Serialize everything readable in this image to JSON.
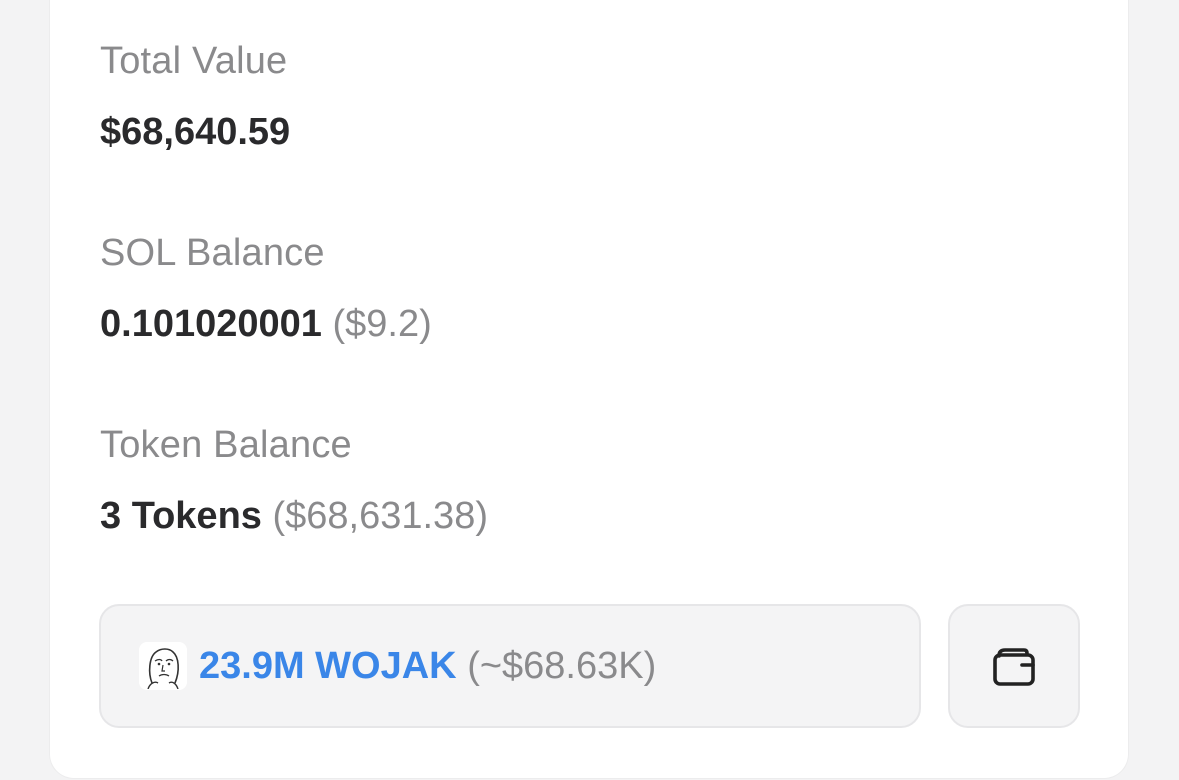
{
  "summary": {
    "total_value_label": "Total Value",
    "total_value": "$68,640.59",
    "sol_balance_label": "SOL Balance",
    "sol_balance": "0.101020001",
    "sol_balance_usd": "($9.2)",
    "token_balance_label": "Token Balance",
    "token_balance": "3 Tokens",
    "token_balance_usd": "($68,631.38)"
  },
  "token": {
    "icon": "wojak-face-icon",
    "amount": "23.9M WOJAK",
    "usd": "(~$68.63K)"
  },
  "actions": {
    "wallet_icon": "wallet-icon"
  },
  "colors": {
    "accent": "#3a86e8",
    "muted_text": "#8a8a8c",
    "strong_text": "#2a2a2c"
  }
}
